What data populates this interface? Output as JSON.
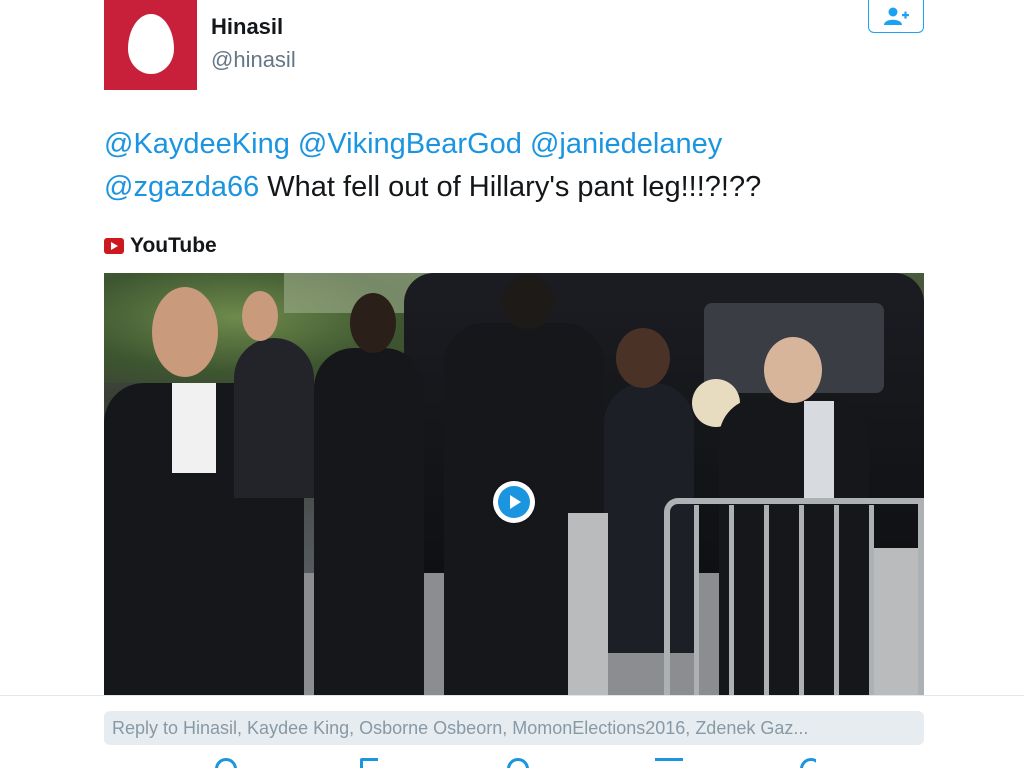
{
  "author": {
    "display_name": "Hinasil",
    "handle": "@hinasil",
    "avatar_color": "#c8203a"
  },
  "follow_button": {
    "icon": "add-user-icon"
  },
  "tweet": {
    "mentions": [
      "@KaydeeKing",
      "@VikingBearGod",
      "@janiedelaney",
      "@zgazda66"
    ],
    "text": "What fell out of Hillary's pant leg!!!?!??"
  },
  "card": {
    "source": "YouTube",
    "play_icon": "play-icon"
  },
  "reply": {
    "placeholder": "Reply to Hinasil, Kaydee King, Osborne Osbeorn, MomonElections2016, Zdenek Gaz..."
  },
  "actions": [
    "reply-icon",
    "retweet-icon",
    "like-icon",
    "share-icon",
    "more-icon"
  ],
  "colors": {
    "accent": "#1b95e0",
    "text": "#14171a",
    "muted": "#657786"
  }
}
